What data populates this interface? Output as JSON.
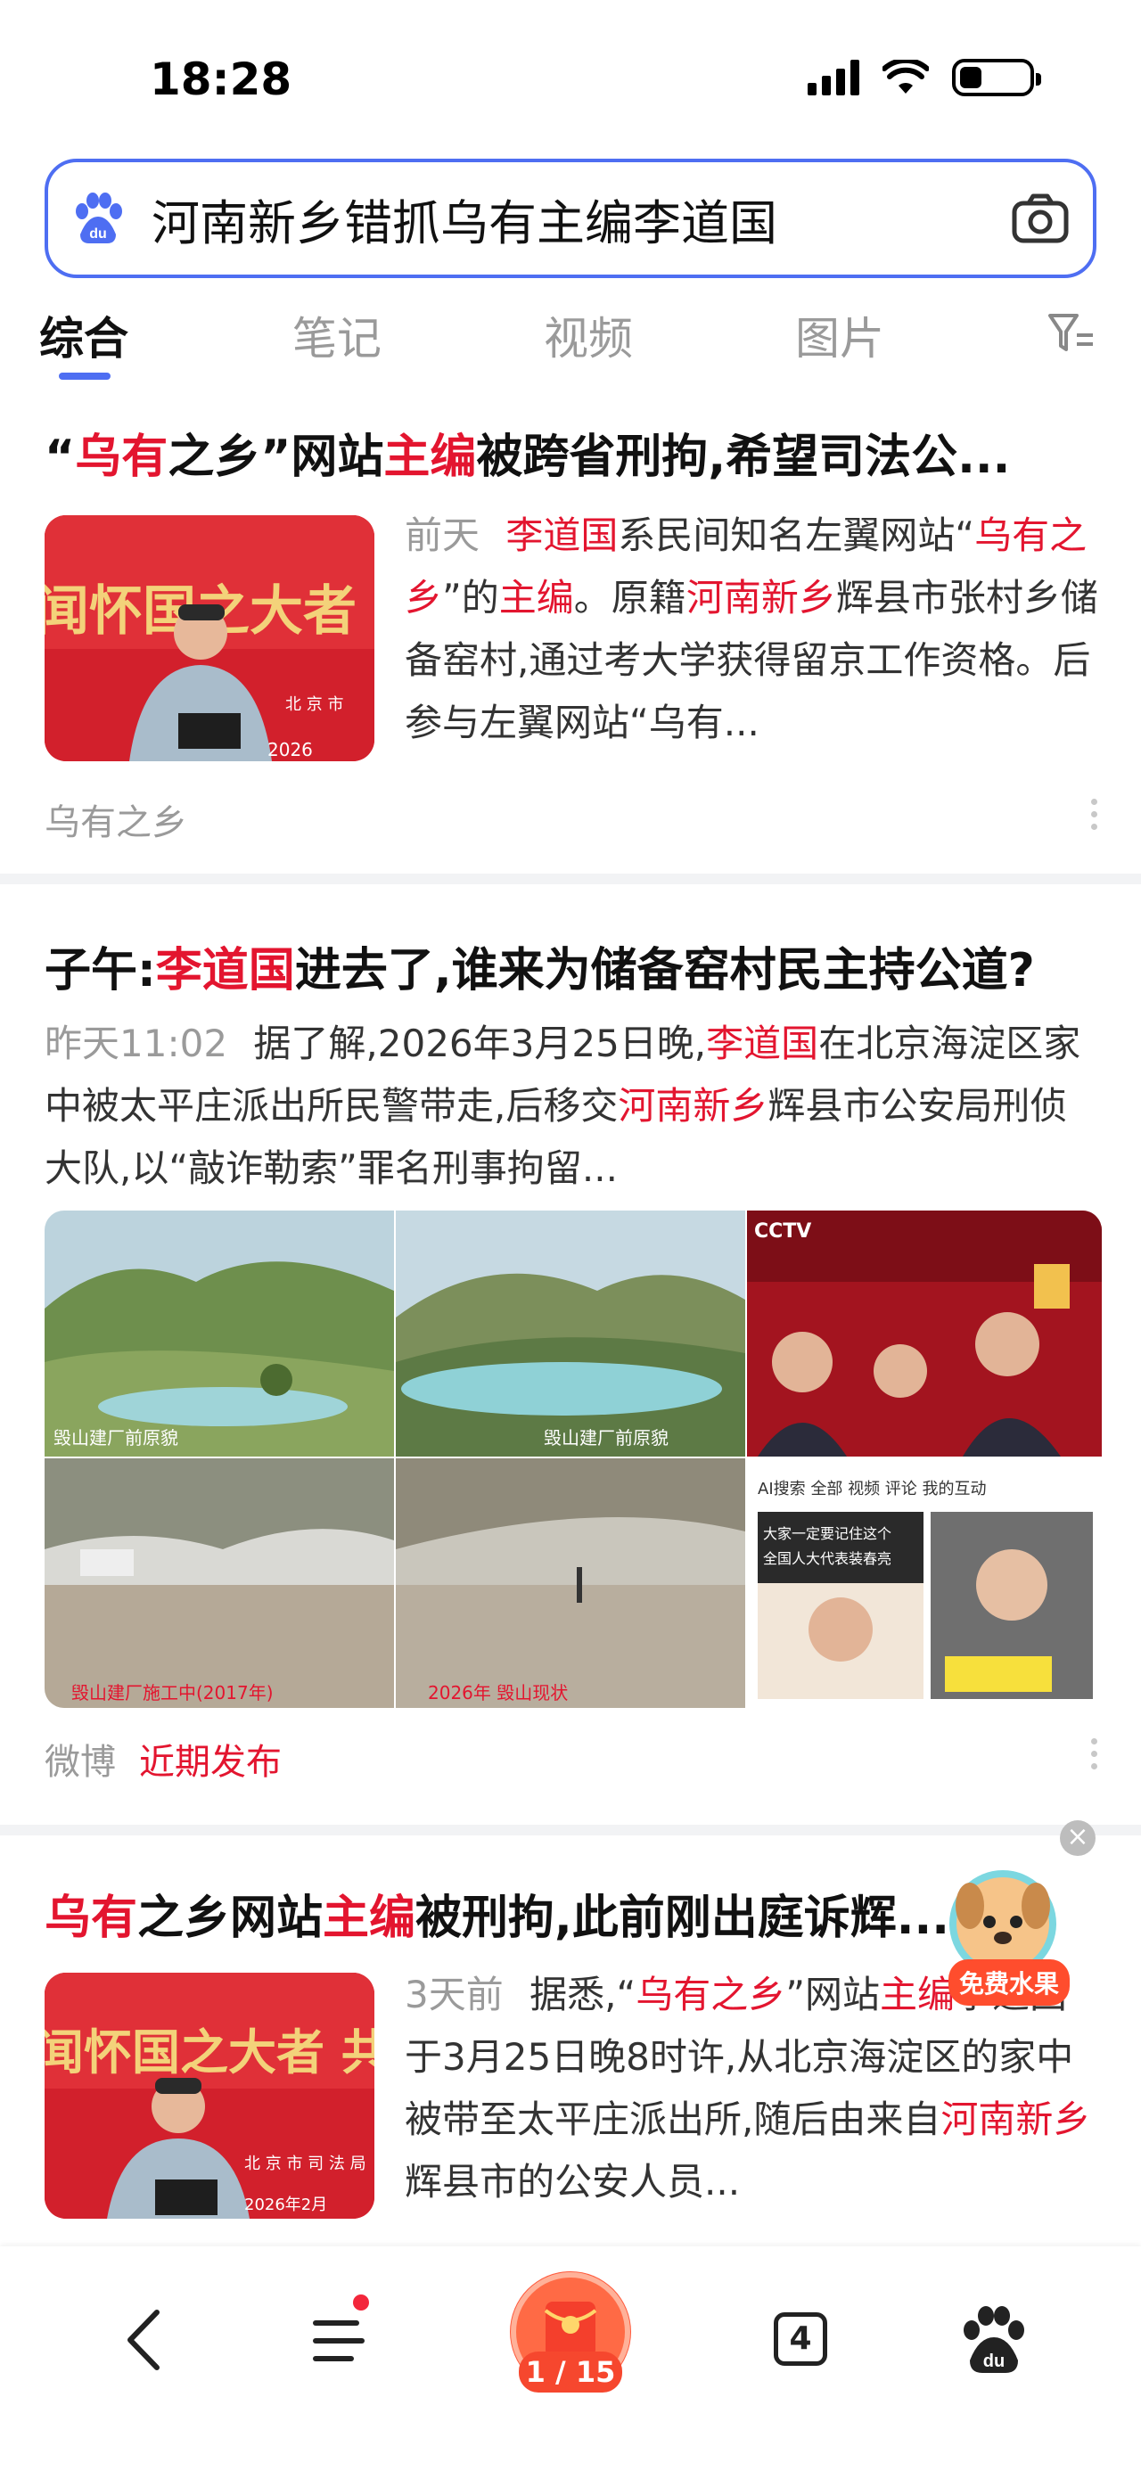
{
  "status": {
    "time": "18:28"
  },
  "search": {
    "query": "河南新乡错抓乌有主编李道国"
  },
  "tabs": [
    "综合",
    "笔记",
    "视频",
    "图片"
  ],
  "result1": {
    "title": [
      "“",
      "乌有",
      "之乡”网站",
      "主编",
      "被跨省刑拘,希望司法公..."
    ],
    "time": "前天",
    "summary": [
      "李道国",
      "系民间知名左翼网站“",
      "乌有之乡",
      "”的",
      "主编",
      "。原籍",
      "河南新乡",
      "辉县市张村乡储备窑村,通过考大学获得留京工作资格。后参与左翼网站“乌有..."
    ],
    "source": "乌有之乡"
  },
  "result2": {
    "title": [
      "子午:",
      "李道国",
      "进去了,谁来为储备窑村民主持公道?"
    ],
    "time": "昨天11:02",
    "summary": [
      "据了解,2026年3月25日晚,",
      "李道国",
      "在北京海淀区家中被太平庄派出所民警带走,后移交",
      "河南新乡",
      "辉县市公安局刑侦大队,以“敲诈勒索”罪名刑事拘留..."
    ],
    "source": "微博",
    "badge": "近期发布"
  },
  "result3": {
    "title": [
      "乌有",
      "之乡网站",
      "主编",
      "被刑拘,此前刚出庭诉辉..."
    ],
    "time": "3天前",
    "summary": [
      "据悉,“",
      "乌有之乡",
      "”网站",
      "主编",
      "李道国",
      "于3月25日晚8时许,从北京海淀区的家中被带至太平庄派出所,随后由来自",
      "河南新乡",
      "辉县市的公安人员..."
    ]
  },
  "floating": {
    "label": "免费水果"
  },
  "bottom_nav": {
    "tab_count": "4",
    "page_counter": "1 / 15"
  },
  "colors": {
    "accent": "#4e6ef2",
    "highlight": "#e3152f"
  }
}
